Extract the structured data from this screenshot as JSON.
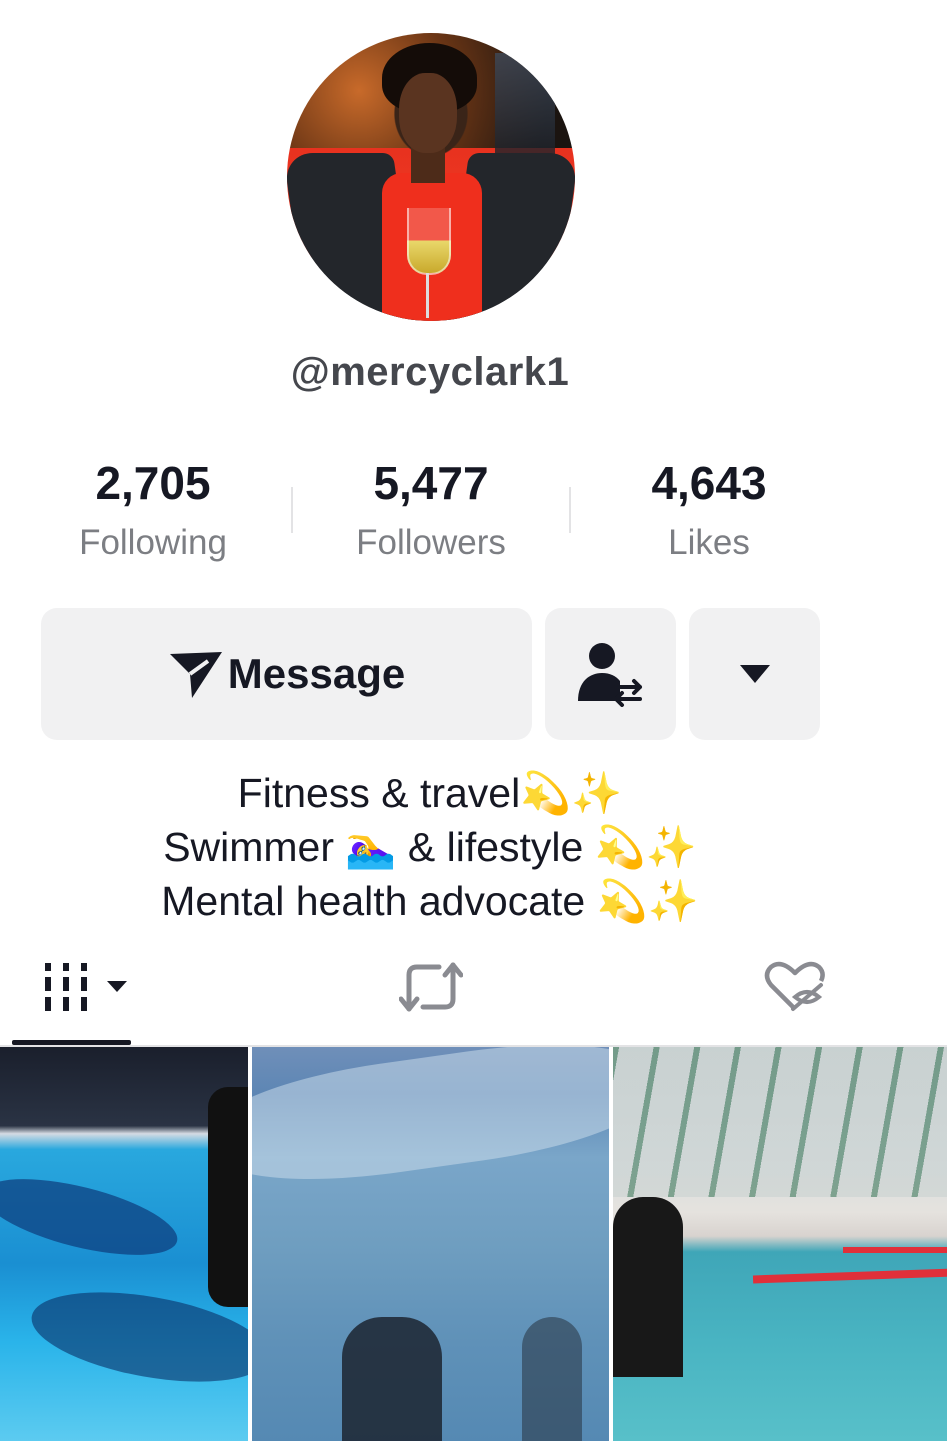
{
  "profile": {
    "username": "@mercyclark1",
    "avatar_icon": "profile-photo"
  },
  "stats": [
    {
      "value": "2,705",
      "label": "Following"
    },
    {
      "value": "5,477",
      "label": "Followers"
    },
    {
      "value": "4,643",
      "label": "Likes"
    }
  ],
  "actions": {
    "message_label": "Message",
    "message_icon": "send-icon",
    "friend_icon": "user-switch-icon",
    "more_icon": "caret-down-icon"
  },
  "bio": {
    "line1_text": "Fitness & travel",
    "line1_emoji": "💫✨",
    "line2_text_a": "Swimmer ",
    "line2_emoji_a": "🏊‍♀️",
    "line2_text_b": " & lifestyle ",
    "line2_emoji_b": "💫✨",
    "line3_text": "Mental health advocate ",
    "line3_emoji": "💫✨"
  },
  "tabs": [
    {
      "icon": "videos-grid-icon",
      "active": true
    },
    {
      "icon": "repost-icon",
      "active": false
    },
    {
      "icon": "liked-hidden-icon",
      "active": false
    }
  ],
  "colors": {
    "text_primary": "#161823",
    "text_secondary": "#7c7e83",
    "button_bg": "#f1f1f2"
  }
}
